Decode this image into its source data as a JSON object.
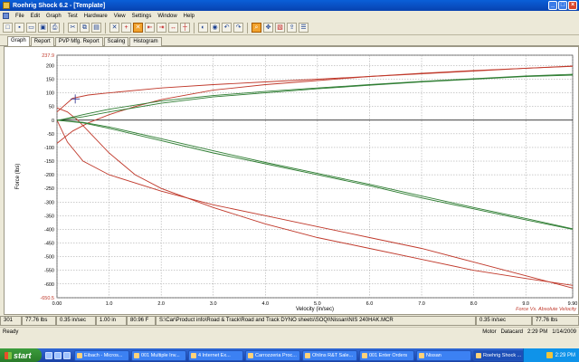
{
  "window": {
    "title": "Roehrig Shock 6.2 - [Template]",
    "controls": [
      "_",
      "□",
      "×"
    ]
  },
  "menu": [
    "File",
    "Edit",
    "Graph",
    "Test",
    "Hardware",
    "View",
    "Settings",
    "Window",
    "Help"
  ],
  "toolbar_icons": [
    "new-icon",
    "save-icon",
    "open-icon",
    "save-as-icon",
    "print-icon",
    "cut-icon",
    "copy-icon",
    "paste-icon",
    "delete-icon",
    "crosshair-icon",
    "pvp-icon",
    "compress-icon",
    "rebound-icon",
    "absolute-icon",
    "zero-icon",
    "motor-icon",
    "datacard-icon",
    "undo-icon",
    "redo-icon",
    "zoom-icon",
    "pan-icon",
    "color-icon",
    "export-icon",
    "legend-icon"
  ],
  "tabs": [
    {
      "label": "Graph",
      "active": true
    },
    {
      "label": "Report",
      "active": false
    },
    {
      "label": "PVP Mfg. Report",
      "active": false
    },
    {
      "label": "Scaling",
      "active": false
    },
    {
      "label": "Histogram",
      "active": false
    }
  ],
  "chart_data": {
    "type": "line",
    "xlabel": "Velocity (in/sec)",
    "ylabel": "Force (lbs)",
    "xlim": [
      0,
      9.9
    ],
    "ylim": [
      -650.5,
      237.9
    ],
    "x_ticks": [
      0.0,
      1.0,
      2.0,
      3.0,
      4.0,
      5.0,
      6.0,
      7.0,
      8.0,
      9.0,
      9.9
    ],
    "x_tick_labels": [
      "0.00",
      "1.0",
      "2.0",
      "3.0",
      "4.0",
      "5.0",
      "6.0",
      "7.0",
      "8.0",
      "9.0",
      "9.90"
    ],
    "y_ticks": [
      237.9,
      200,
      150,
      100,
      50,
      0,
      -50,
      -100,
      -150,
      -200,
      -250,
      -300,
      -350,
      -400,
      -450,
      -500,
      -550,
      -600,
      -650.5
    ],
    "y_tick_labels": [
      "237.9",
      "200",
      "150",
      "100",
      "50",
      "0",
      "-50",
      "-100",
      "-150",
      "-200",
      "-250",
      "-300",
      "-350",
      "-400",
      "-450",
      "-500",
      "-550",
      "-600",
      "-650.5"
    ],
    "grid": true,
    "annotation": "Force Vs. Absolute Velocity",
    "colors": {
      "red": "#c0392b",
      "green": "#2e7d32"
    },
    "series": [
      {
        "color": "red",
        "x": [
          0.0,
          0.3,
          0.6,
          1.0,
          2.0,
          3.0,
          4.0,
          5.0,
          6.0,
          7.0,
          8.0,
          9.0,
          9.9
        ],
        "y": [
          30,
          80,
          92,
          100,
          118,
          130,
          140,
          150,
          160,
          170,
          180,
          190,
          198
        ]
      },
      {
        "color": "red",
        "x": [
          0.0,
          0.3,
          0.6,
          1.0,
          1.5,
          2.0,
          3.0,
          4.0,
          5.0,
          6.0,
          7.0,
          8.0,
          9.0,
          9.9
        ],
        "y": [
          -85,
          -40,
          -10,
          20,
          50,
          75,
          110,
          130,
          145,
          160,
          172,
          182,
          190,
          197
        ]
      },
      {
        "color": "red",
        "x": [
          0.0,
          0.2,
          0.4,
          0.6,
          1.0,
          1.5,
          2.0,
          3.0,
          4.0,
          5.0,
          6.0,
          7.0,
          8.0,
          9.0,
          9.9
        ],
        "y": [
          45,
          30,
          0,
          -40,
          -120,
          -200,
          -250,
          -320,
          -380,
          -430,
          -470,
          -510,
          -550,
          -580,
          -605
        ]
      },
      {
        "color": "red",
        "x": [
          0.0,
          0.2,
          0.5,
          1.0,
          2.0,
          3.0,
          4.0,
          5.0,
          6.0,
          7.0,
          8.0,
          9.0,
          9.9
        ],
        "y": [
          0,
          -80,
          -150,
          -200,
          -260,
          -310,
          -350,
          -390,
          -430,
          -470,
          -520,
          -570,
          -615
        ]
      },
      {
        "color": "green",
        "x": [
          0.0,
          0.5,
          1.0,
          2.0,
          3.0,
          4.0,
          5.0,
          6.0,
          7.0,
          8.0,
          9.0,
          9.9
        ],
        "y": [
          -2,
          20,
          40,
          70,
          90,
          105,
          118,
          130,
          142,
          152,
          162,
          168
        ]
      },
      {
        "color": "green",
        "x": [
          0.0,
          0.5,
          1.0,
          2.0,
          3.0,
          4.0,
          5.0,
          6.0,
          7.0,
          8.0,
          9.0,
          9.9
        ],
        "y": [
          0,
          12,
          30,
          62,
          85,
          100,
          115,
          128,
          140,
          150,
          160,
          165
        ]
      },
      {
        "color": "green",
        "x": [
          0.0,
          0.5,
          1.0,
          2.0,
          3.0,
          4.0,
          5.0,
          6.0,
          7.0,
          8.0,
          9.0,
          9.9
        ],
        "y": [
          0,
          -10,
          -30,
          -75,
          -120,
          -160,
          -200,
          -240,
          -285,
          -325,
          -365,
          -400
        ]
      },
      {
        "color": "green",
        "x": [
          0.0,
          0.5,
          1.0,
          2.0,
          3.0,
          4.0,
          5.0,
          6.0,
          7.0,
          8.0,
          9.0,
          9.9
        ],
        "y": [
          0,
          -8,
          -25,
          -68,
          -112,
          -155,
          -195,
          -235,
          -278,
          -320,
          -360,
          -398
        ]
      }
    ],
    "cursor": {
      "x": 0.35,
      "y": 77.76
    }
  },
  "readout": {
    "index": "301",
    "force": "77.76 lbs",
    "velocity": "0.35 in/sec",
    "displacement": "1.00 in",
    "temperature": "80.96 F",
    "file_path": "S:\\Car\\Product info\\Road & Track\\Road and Track DYNO sheets\\SOQI\\Nissan\\NIS 240HAK.MCR",
    "velocity2": "0.35 in/sec",
    "force2": "77.76 lbs"
  },
  "statusbar": {
    "left": "Ready",
    "motor": "Motor",
    "datacard": "Datacard",
    "time": "2:29 PM",
    "date": "1/14/2009"
  },
  "taskbar": {
    "start": "start",
    "tasks": [
      "Eibach - Micros...",
      "001 Multiple Inv...",
      "4 Internet Ex...",
      "Carrozzeria Proc...",
      "Ohlins R&T Sale...",
      "001 Enter Orders",
      "Nissan",
      "Roehrig Shock ..."
    ],
    "active_task": 7,
    "clock": "2:29 PM"
  }
}
